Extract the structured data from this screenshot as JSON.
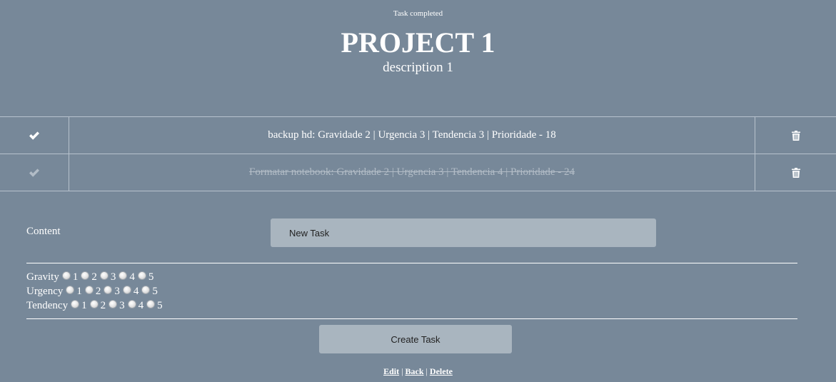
{
  "notice": "Task completed",
  "project": {
    "title": "PROJECT 1",
    "description": "description 1"
  },
  "tasks": [
    {
      "text": "backup hd: Gravidade 2 | Urgencia 3 | Tendencia 3 | Prioridade - 18",
      "completed": false,
      "check_icon": "check-icon",
      "delete_icon": "trash-icon"
    },
    {
      "text": "Formatar notebook: Gravidade 2 | Urgencia 3 | Tendencia 4 | Prioridade - 24",
      "completed": true,
      "check_icon": "check-icon",
      "delete_icon": "trash-icon"
    }
  ],
  "form": {
    "content_label": "Content",
    "content_value": "New Task",
    "ratings": [
      {
        "label": "Gravity",
        "options": [
          "1",
          "2",
          "3",
          "4",
          "5"
        ]
      },
      {
        "label": "Urgency",
        "options": [
          "1",
          "2",
          "3",
          "4",
          "5"
        ]
      },
      {
        "label": "Tendency",
        "options": [
          "1",
          "2",
          "3",
          "4",
          "5"
        ]
      }
    ],
    "submit_label": "Create Task"
  },
  "footer": {
    "edit": "Edit",
    "back": "Back",
    "delete": "Delete",
    "separator": " | "
  },
  "colors": {
    "background": "#778899",
    "button": "#a9b5bf",
    "text": "#ffffff"
  }
}
